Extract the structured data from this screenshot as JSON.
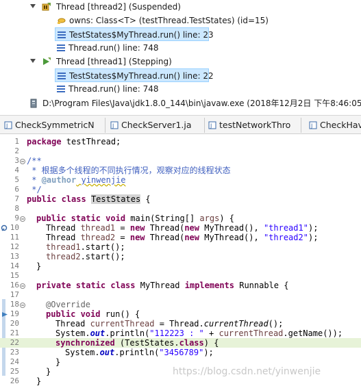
{
  "debug": {
    "rows": [
      {
        "id": "thread2",
        "text": "Thread [thread2] (Suspended)",
        "kind": "thread-suspended"
      },
      {
        "id": "owns",
        "text": "owns: Class<T> (testThread.TestStates) (id=15)",
        "kind": "monitor"
      },
      {
        "id": "t2-frame1",
        "text": "TestStates$MyThread.run() line: 23",
        "kind": "frame",
        "selected": true
      },
      {
        "id": "t2-frame2",
        "text": "Thread.run() line: 748",
        "kind": "frame"
      },
      {
        "id": "thread1",
        "text": "Thread [thread1] (Stepping)",
        "kind": "thread-stepping"
      },
      {
        "id": "t1-frame1",
        "text": "TestStates$MyThread.run() line: 22",
        "kind": "frame",
        "selected": true
      },
      {
        "id": "t1-frame2",
        "text": "Thread.run() line: 748",
        "kind": "frame"
      },
      {
        "id": "javaw",
        "text": "D:\\Program Files\\Java\\jdk1.8.0_144\\bin\\javaw.exe (2018年12月2日 下午8:46:05)",
        "kind": "process"
      }
    ]
  },
  "tabs": [
    {
      "label": "CheckSymmetricN"
    },
    {
      "label": "CheckServer1.ja"
    },
    {
      "label": "testNetworkThro"
    },
    {
      "label": "CheckHave"
    }
  ],
  "editor": {
    "line_numbers": [
      "1",
      "2",
      "3",
      "4",
      "5",
      "6",
      "7",
      "8",
      "9",
      "10",
      "11",
      "12",
      "13",
      "14",
      "15",
      "16",
      "17",
      "18",
      "19",
      "20",
      "21",
      "22",
      "23",
      "24",
      "25",
      "26"
    ],
    "code": {
      "l1_kw": "package",
      "l1_rest": " testThread;",
      "l3": "/**",
      "l4": " * 根据多个线程的不同执行情况，观察对应的线程状态",
      "l5_pre": " * ",
      "l5_tag": "@author",
      "l5_rest": " yinwenjie",
      "l6": " */",
      "l7_kw": "public class",
      "l7_sp": " ",
      "l7_name": "TestStates",
      "l7_rest": " {",
      "l9_kw": "public static void",
      "l9_rest": " main(String[] ",
      "l9_var": "args",
      "l9_end": ") {",
      "l10_a": "Thread ",
      "l10_var": "thread1",
      "l10_b": " = ",
      "l10_new1": "new",
      "l10_c": " Thread(",
      "l10_new2": "new",
      "l10_d": " MyThread(), ",
      "l10_str": "\"thread1\"",
      "l10_e": ");",
      "l11_a": "Thread ",
      "l11_var": "thread2",
      "l11_b": " = ",
      "l11_new1": "new",
      "l11_c": " Thread(",
      "l11_new2": "new",
      "l11_d": " MyThread(), ",
      "l11_str": "\"thread2\"",
      "l11_e": ");",
      "l12_var": "thread1",
      "l12_rest": ".start();",
      "l13_var": "thread2",
      "l13_rest": ".start();",
      "l14": "}",
      "l16_kw": "private static class",
      "l16_a": " MyThread ",
      "l16_kw2": "implements",
      "l16_b": " Runnable {",
      "l18": "@Override",
      "l19_kw": "public void",
      "l19_rest": " run() {",
      "l20_a": "Thread ",
      "l20_var": "currentThread",
      "l20_b": " = Thread.",
      "l20_it": "currentThread",
      "l20_c": "();",
      "l21_a": "System.",
      "l21_fld": "out",
      "l21_b": ".println(",
      "l21_str": "\"112223 : \"",
      "l21_c": " + ",
      "l21_var": "currentThread",
      "l21_d": ".getName());",
      "l22_kw": "synchronized",
      "l22_a": " (TestStates.",
      "l22_kw2": "class",
      "l22_b": ") {",
      "l23_a": "System.",
      "l23_fld": "out",
      "l23_b": ".println(",
      "l23_str": "\"3456789\"",
      "l23_c": ");",
      "l24": "}",
      "l25": "}",
      "l26": "}"
    }
  },
  "watermark": "https://blog.csdn.net/yinwenjie",
  "colors": {
    "selection": "#cce8ff",
    "current_line": "#e7f3d8",
    "keyword": "#7f0055",
    "comment": "#3f5fbf",
    "string": "#2a00ff"
  }
}
